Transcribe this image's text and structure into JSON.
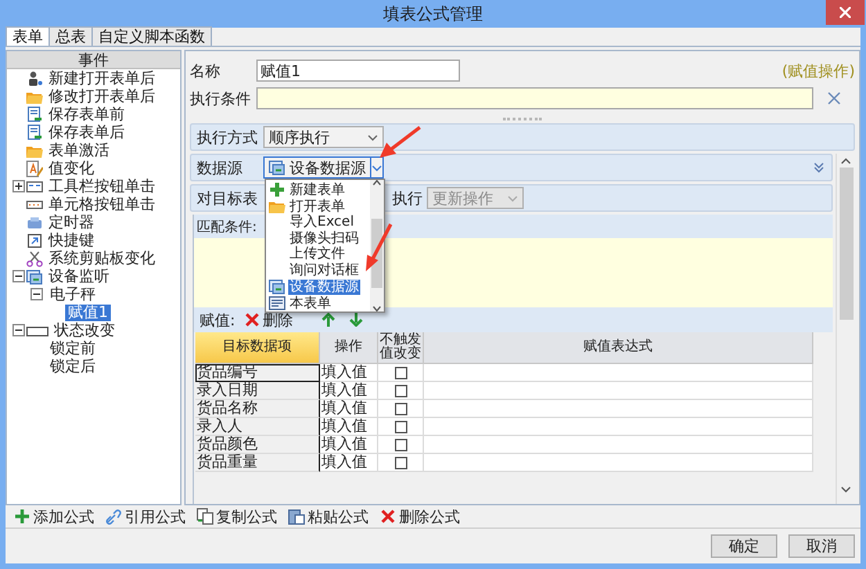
{
  "window": {
    "title": "填表公式管理"
  },
  "tabs": [
    {
      "label": "表单",
      "selected": true
    },
    {
      "label": "总表",
      "selected": false
    },
    {
      "label": "自定义脚本函数",
      "selected": false
    }
  ],
  "event_tree": {
    "header": "事件",
    "items": [
      {
        "label": "新建打开表单后",
        "kind": "person",
        "selected": false
      },
      {
        "label": "修改打开表单后",
        "kind": "folder",
        "selected": false
      },
      {
        "label": "保存表单前",
        "kind": "save",
        "selected": false
      },
      {
        "label": "保存表单后",
        "kind": "save",
        "selected": false
      },
      {
        "label": "表单激活",
        "kind": "folder",
        "selected": false
      },
      {
        "label": "值变化",
        "kind": "edit",
        "selected": false
      },
      {
        "label": "工具栏按钮单击",
        "kind": "toolbar",
        "selected": false,
        "expanded": false
      },
      {
        "label": "单元格按钮单击",
        "kind": "cell",
        "selected": false
      },
      {
        "label": "定时器",
        "kind": "timer",
        "selected": false
      },
      {
        "label": "快捷键",
        "kind": "shortcut",
        "selected": false
      },
      {
        "label": "系统剪贴板变化",
        "kind": "scissors",
        "selected": false
      },
      {
        "label": "设备监听",
        "kind": "device",
        "selected": false,
        "expanded": true,
        "children": [
          {
            "label": "电子秤",
            "selected": false,
            "expanded": true,
            "children": [
              {
                "label": "赋值1",
                "selected": true
              }
            ]
          }
        ]
      },
      {
        "label": "状态改变",
        "kind": "state",
        "selected": false,
        "expanded": true,
        "children": [
          {
            "label": "锁定前",
            "selected": false
          },
          {
            "label": "锁定后",
            "selected": false
          }
        ]
      }
    ]
  },
  "form": {
    "name_label": "名称",
    "name_value": "赋值1",
    "mode_note": "(赋值操作)",
    "condition_label": "执行条件"
  },
  "exec_mode": {
    "label": "执行方式",
    "value": "顺序执行"
  },
  "data_source": {
    "label": "数据源",
    "value": "设备数据源",
    "open": true,
    "options": [
      {
        "label": "新建表单",
        "kind": "plus",
        "selected": false
      },
      {
        "label": "打开表单",
        "kind": "folder",
        "selected": false
      },
      {
        "label": "导入Excel",
        "selected": false
      },
      {
        "label": "摄像头扫码",
        "selected": false
      },
      {
        "label": "上传文件",
        "selected": false
      },
      {
        "label": "询问对话框",
        "selected": false
      },
      {
        "label": "设备数据源",
        "kind": "device",
        "selected": true
      },
      {
        "label": "本表单",
        "kind": "form",
        "selected": false
      }
    ]
  },
  "target": {
    "label": "对目标表",
    "exec_label": "执行",
    "exec_value": "更新操作",
    "exec_disabled": true,
    "match_label": "匹配条件:"
  },
  "assign": {
    "label": "赋值:",
    "delete_label": "删除"
  },
  "grid": {
    "columns": [
      {
        "label": "目标数据项",
        "selected": true
      },
      {
        "label": "操作",
        "selected": false
      },
      {
        "label": "不触发值改变",
        "selected": false
      },
      {
        "label": "赋值表达式",
        "selected": false
      }
    ],
    "rows": [
      {
        "item": "货品编号",
        "operation": "填入值",
        "no_trigger": false,
        "focused": true
      },
      {
        "item": "录入日期",
        "operation": "填入值",
        "no_trigger": false,
        "focused": false
      },
      {
        "item": "货品名称",
        "operation": "填入值",
        "no_trigger": false,
        "focused": false
      },
      {
        "item": "录入人",
        "operation": "填入值",
        "no_trigger": false,
        "focused": false
      },
      {
        "item": "货品颜色",
        "operation": "填入值",
        "no_trigger": false,
        "focused": false
      },
      {
        "item": "货品重量",
        "operation": "填入值",
        "no_trigger": false,
        "focused": false
      }
    ]
  },
  "toolbar": [
    {
      "kind": "add",
      "label": "添加公式"
    },
    {
      "kind": "link",
      "label": "引用公式"
    },
    {
      "kind": "copy",
      "label": "复制公式"
    },
    {
      "kind": "paste",
      "label": "粘贴公式"
    },
    {
      "kind": "delete",
      "label": "删除公式"
    }
  ],
  "buttons": [
    {
      "label": "确定"
    },
    {
      "label": "取消"
    }
  ]
}
